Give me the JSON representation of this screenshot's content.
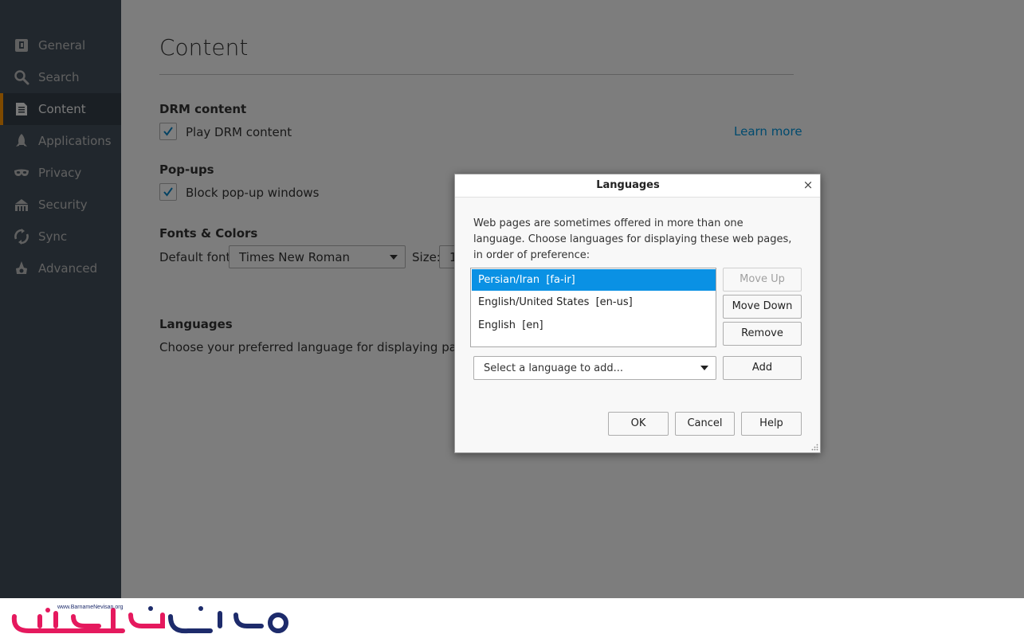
{
  "sidebar": {
    "items": [
      {
        "label": "General",
        "icon": "general-icon"
      },
      {
        "label": "Search",
        "icon": "search-icon"
      },
      {
        "label": "Content",
        "icon": "content-icon",
        "selected": true
      },
      {
        "label": "Applications",
        "icon": "applications-icon"
      },
      {
        "label": "Privacy",
        "icon": "privacy-mask-icon"
      },
      {
        "label": "Security",
        "icon": "security-icon"
      },
      {
        "label": "Sync",
        "icon": "sync-icon"
      },
      {
        "label": "Advanced",
        "icon": "advanced-icon"
      }
    ]
  },
  "main": {
    "title": "Content",
    "drm": {
      "heading": "DRM content",
      "checkbox_label": "Play DRM content",
      "checked": true,
      "learn_more": "Learn more"
    },
    "popups": {
      "heading": "Pop-ups",
      "checkbox_label": "Block pop-up windows",
      "checked": true
    },
    "fonts": {
      "heading": "Fonts & Colors",
      "default_font_label": "Default font:",
      "default_font_value": "Times New Roman",
      "size_label": "Size:",
      "size_value": "1"
    },
    "languages": {
      "heading": "Languages",
      "description": "Choose your preferred language for displaying pages"
    }
  },
  "dialog": {
    "title": "Languages",
    "close": "×",
    "description": "Web pages are sometimes offered in more than one language. Choose languages for displaying these web pages, in order of preference:",
    "languages": [
      {
        "label": "Persian/Iran  [fa-ir]",
        "selected": true
      },
      {
        "label": "English/United States  [en-us]",
        "selected": false
      },
      {
        "label": "English  [en]",
        "selected": false
      }
    ],
    "move_up": "Move Up",
    "move_down": "Move Down",
    "remove": "Remove",
    "select_placeholder": "Select a language to add...",
    "add": "Add",
    "ok": "OK",
    "cancel": "Cancel",
    "help": "Help"
  },
  "watermark": {
    "text": "www.BarnameNevisan.org"
  },
  "colors": {
    "accent": "#ff9500",
    "selection": "#0a91e4",
    "link": "#0095dd",
    "sidebar_bg": "#424f5a"
  }
}
